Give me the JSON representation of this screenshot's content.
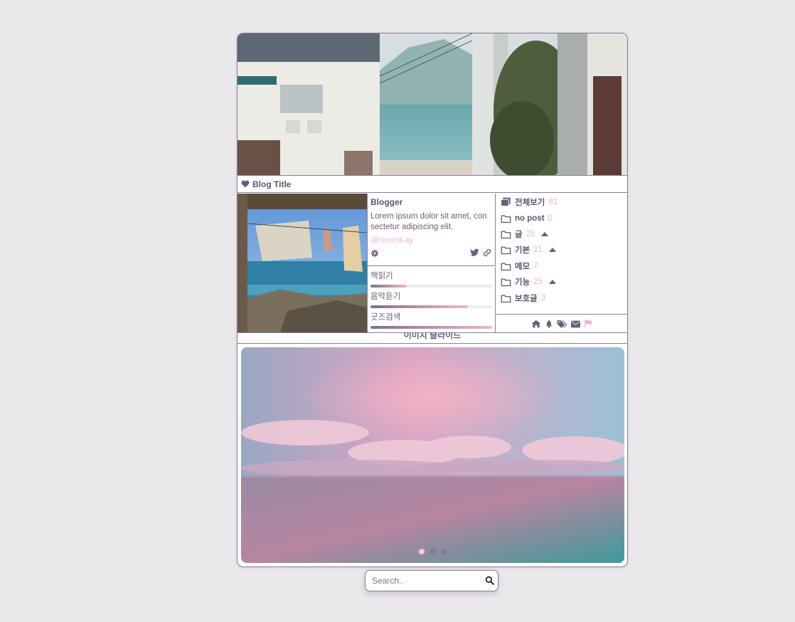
{
  "header": {
    "image": "street-sea-photo"
  },
  "title_bar": {
    "icon": "heart-icon",
    "title": "Blog Title"
  },
  "profile": {
    "image": "laundry-sea-photo",
    "name": "Blogger",
    "description": "Lorem ipsum dolor sit amet, con sectetur adipiscing elit.",
    "handle": "@record-ay",
    "icons": {
      "settings": "gear-icon",
      "twitter": "twitter-icon",
      "link": "link-icon"
    }
  },
  "progress": [
    {
      "label": "책읽기",
      "value": 0.3
    },
    {
      "label": "음악듣기",
      "value": 0.8
    },
    {
      "label": "굿즈검색",
      "value": 1.0
    }
  ],
  "categories": [
    {
      "name": "전체보기",
      "count": "81",
      "icon": "stack-icon",
      "expandable": false
    },
    {
      "name": "no post",
      "count": "0",
      "icon": "folder-icon",
      "expandable": false
    },
    {
      "name": "글",
      "count": "25",
      "icon": "folder-icon",
      "expandable": true
    },
    {
      "name": "기본",
      "count": "21",
      "icon": "folder-icon",
      "expandable": true
    },
    {
      "name": "메모",
      "count": "7",
      "icon": "folder-icon",
      "expandable": false
    },
    {
      "name": "기능",
      "count": "25",
      "icon": "folder-icon",
      "expandable": true
    },
    {
      "name": "보호글",
      "count": "3",
      "icon": "folder-icon",
      "expandable": false
    }
  ],
  "nav_icons": [
    "home-icon",
    "bell-icon",
    "tags-icon",
    "envelope-icon",
    "flag-icon"
  ],
  "slider": {
    "label": "이미지 슬라이드",
    "image": "pink-sky-sea-photo",
    "total_slides": 3,
    "active_slide": 1
  },
  "search": {
    "placeholder": "Search..",
    "icon": "search-icon"
  },
  "colors": {
    "background": "#ebe8ec",
    "border": "#8a7d96",
    "text": "#6a5c7a",
    "accent_pink": "#f2b3c9"
  }
}
